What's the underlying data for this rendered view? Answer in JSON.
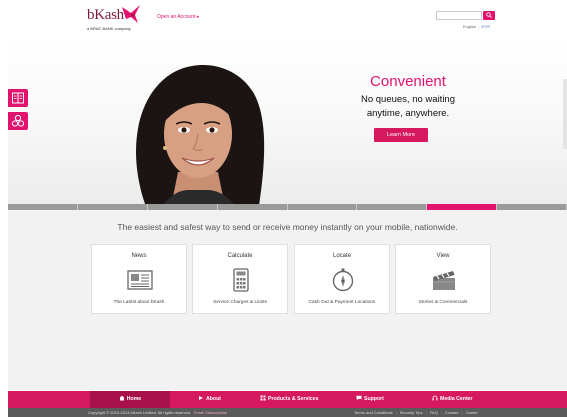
{
  "header": {
    "logo_text": "bKash",
    "logo_tagline": "a BRAC BANK company",
    "open_account": "Open an Account",
    "open_account_arrow": "▸",
    "search_placeholder": "",
    "lang_english": "English",
    "lang_bangla": "বাংলা",
    "lang_separator": "|"
  },
  "hero": {
    "headline": "Convenient",
    "line1": "No queues, no waiting",
    "line2": "anytime, anywhere.",
    "cta": "Learn More"
  },
  "side_tabs": [
    {
      "icon": "book-icon"
    },
    {
      "icon": "share-icon"
    }
  ],
  "slider": {
    "segments": 8,
    "active_index": 6
  },
  "tagline": "The easiest and safest way to send or receive money instantly on your mobile, nationwide.",
  "cards": [
    {
      "title": "News",
      "icon": "newspaper-icon",
      "desc": "The Latest about bKash"
    },
    {
      "title": "Calculate",
      "icon": "calculator-icon",
      "desc": "Service Charges & Limits"
    },
    {
      "title": "Locate",
      "icon": "compass-icon",
      "desc": "Cash Out & Payment Locations"
    },
    {
      "title": "View",
      "icon": "clapperboard-icon",
      "desc": "Stories & Commercials"
    }
  ],
  "nav": [
    {
      "label": "Home",
      "icon": "home-icon",
      "active": true
    },
    {
      "label": "About",
      "icon": "arrow-icon",
      "active": false
    },
    {
      "label": "Products & Services",
      "icon": "grid-icon",
      "active": false
    },
    {
      "label": "Support",
      "icon": "chat-icon",
      "active": false
    },
    {
      "label": "Media Center",
      "icon": "headset-icon",
      "active": false
    }
  ],
  "footer": {
    "copyright": "Copyright © 2010-2014 bKash Limited. All rights reserved.",
    "email_subscription": "Email Subscription",
    "links": [
      "Terms and Conditions",
      "Security Tips",
      "FAQ",
      "Contact",
      "Career"
    ],
    "link_separator": "|"
  },
  "colors": {
    "brand_pink": "#e2136e",
    "brand_dark": "#7a1b40",
    "nav_bg": "#d6185f",
    "nav_active": "#a8104a",
    "footer_bg": "#5a5a5a"
  }
}
